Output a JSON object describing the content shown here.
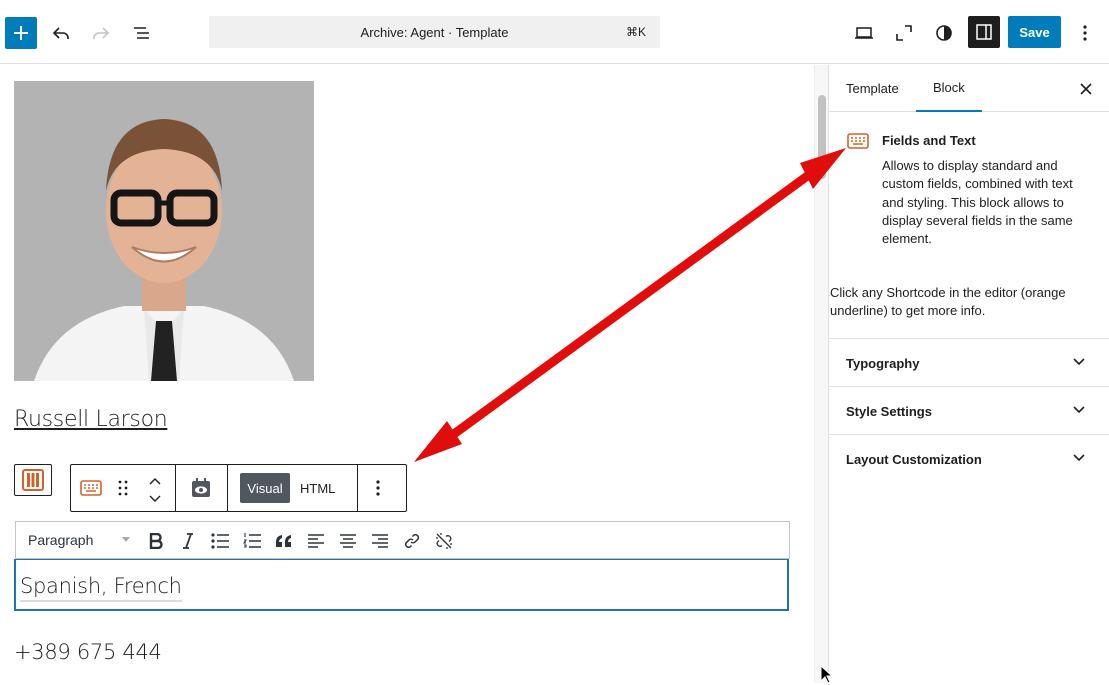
{
  "topbar": {
    "add_label": "Add block",
    "command_title": "Archive: Agent · Template",
    "command_shortcut": "⌘K",
    "save_label": "Save",
    "accent_color": "#007cba"
  },
  "canvas": {
    "agent_name": "Russell Larson",
    "toolbar": {
      "visual_label": "Visual",
      "html_label": "HTML"
    },
    "format_bar": {
      "select_value": "Paragraph"
    },
    "editor_text": "Spanish, French",
    "phone": "+389 675 444"
  },
  "sidebar": {
    "tabs": [
      {
        "label": "Template"
      },
      {
        "label": "Block"
      }
    ],
    "block_card": {
      "title": "Fields and Text",
      "description": "Allows to display standard and custom fields, combined with text and styling. This block allows to display several fields in the same element."
    },
    "hint": "Click any Shortcode in the editor (orange underline) to get more info.",
    "panels": [
      {
        "title": "Typography"
      },
      {
        "title": "Style Settings"
      },
      {
        "title": "Layout Customization"
      }
    ]
  },
  "colors": {
    "block_icon": "#d4632a",
    "annotation_arrow": "#e10c0c"
  }
}
